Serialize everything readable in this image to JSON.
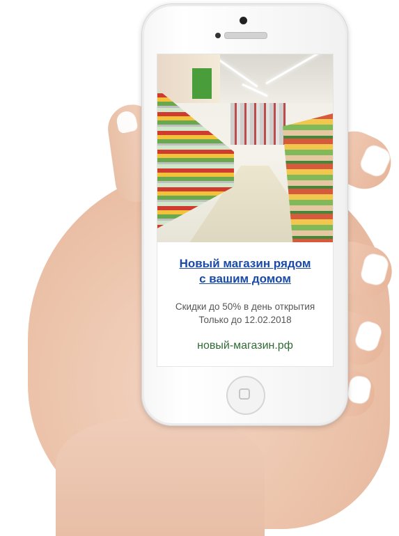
{
  "ad": {
    "headline_line1": "Новый магазин рядом",
    "headline_line2": "с вашим домом",
    "promo_line1": "Скидки до 50% в день открытия",
    "promo_line2": "Только до 12.02.2018",
    "domain": "новый-магазин.рф",
    "image_icon": "store-photo-icon"
  },
  "colors": {
    "headline": "#1a4aa8",
    "promo_text": "#555555",
    "domain": "#2f6b33"
  }
}
